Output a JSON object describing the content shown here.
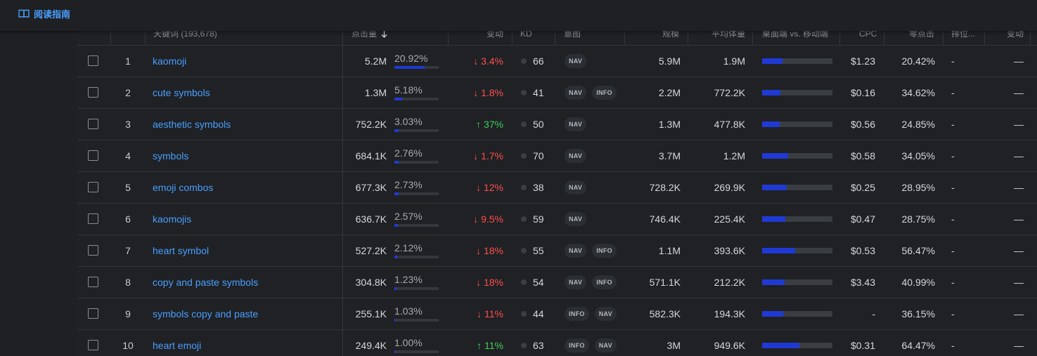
{
  "topbar": {
    "guide_label": "阅读指南"
  },
  "headers": {
    "keyword": "天键词 (193,678)",
    "clicks": "点击量",
    "change": "变动",
    "kd": "KD",
    "intent": "意图",
    "scale": "规模",
    "avg_volume": "平均体量",
    "desktop_mobile": "桌面端 vs. 移动端",
    "cpc": "CPC",
    "zero_click": "零点击",
    "rank": "排位...",
    "change2": "变动"
  },
  "rows": [
    {
      "num": "1",
      "keyword": "kaomoji",
      "clicks": "5.2M",
      "share": "20.92%",
      "share_pct": 20.92,
      "change": "↓ 3.4%",
      "dir": "down",
      "kd": "66",
      "intents": [
        "NAV"
      ],
      "scale": "5.9M",
      "avg": "1.9M",
      "desktop_frac": 0.29,
      "cpc": "$1.23",
      "zero": "20.42%",
      "rank": "-",
      "chg2": "—"
    },
    {
      "num": "2",
      "keyword": "cute symbols",
      "clicks": "1.3M",
      "share": "5.18%",
      "share_pct": 5.18,
      "change": "↓ 1.8%",
      "dir": "down",
      "kd": "41",
      "intents": [
        "NAV",
        "INFO"
      ],
      "scale": "2.2M",
      "avg": "772.2K",
      "desktop_frac": 0.26,
      "cpc": "$0.16",
      "zero": "34.62%",
      "rank": "-",
      "chg2": "—"
    },
    {
      "num": "3",
      "keyword": "aesthetic symbols",
      "clicks": "752.2K",
      "share": "3.03%",
      "share_pct": 3.03,
      "change": "↑ 37%",
      "dir": "up",
      "kd": "50",
      "intents": [
        "NAV"
      ],
      "scale": "1.3M",
      "avg": "477.8K",
      "desktop_frac": 0.25,
      "cpc": "$0.56",
      "zero": "24.85%",
      "rank": "-",
      "chg2": "—"
    },
    {
      "num": "4",
      "keyword": "symbols",
      "clicks": "684.1K",
      "share": "2.76%",
      "share_pct": 2.76,
      "change": "↓ 1.7%",
      "dir": "down",
      "kd": "70",
      "intents": [
        "NAV"
      ],
      "scale": "3.7M",
      "avg": "1.2M",
      "desktop_frac": 0.37,
      "cpc": "$0.58",
      "zero": "34.05%",
      "rank": "-",
      "chg2": "—"
    },
    {
      "num": "5",
      "keyword": "emoji combos",
      "clicks": "677.3K",
      "share": "2.73%",
      "share_pct": 2.73,
      "change": "↓ 12%",
      "dir": "down",
      "kd": "38",
      "intents": [
        "NAV"
      ],
      "scale": "728.2K",
      "avg": "269.9K",
      "desktop_frac": 0.35,
      "cpc": "$0.25",
      "zero": "28.95%",
      "rank": "-",
      "chg2": "—"
    },
    {
      "num": "6",
      "keyword": "kaomojis",
      "clicks": "636.7K",
      "share": "2.57%",
      "share_pct": 2.57,
      "change": "↓ 9.5%",
      "dir": "down",
      "kd": "59",
      "intents": [
        "NAV"
      ],
      "scale": "746.4K",
      "avg": "225.4K",
      "desktop_frac": 0.33,
      "cpc": "$0.47",
      "zero": "28.75%",
      "rank": "-",
      "chg2": "—"
    },
    {
      "num": "7",
      "keyword": "heart symbol",
      "clicks": "527.2K",
      "share": "2.12%",
      "share_pct": 2.12,
      "change": "↓ 18%",
      "dir": "down",
      "kd": "55",
      "intents": [
        "NAV",
        "INFO"
      ],
      "scale": "1.1M",
      "avg": "393.6K",
      "desktop_frac": 0.47,
      "cpc": "$0.53",
      "zero": "56.47%",
      "rank": "-",
      "chg2": "—"
    },
    {
      "num": "8",
      "keyword": "copy and paste symbols",
      "clicks": "304.8K",
      "share": "1.23%",
      "share_pct": 1.23,
      "change": "↓ 18%",
      "dir": "down",
      "kd": "54",
      "intents": [
        "NAV",
        "INFO"
      ],
      "scale": "571.1K",
      "avg": "212.2K",
      "desktop_frac": 0.32,
      "cpc": "$3.43",
      "zero": "40.99%",
      "rank": "-",
      "chg2": "—"
    },
    {
      "num": "9",
      "keyword": "symbols copy and paste",
      "clicks": "255.1K",
      "share": "1.03%",
      "share_pct": 1.03,
      "change": "↓ 11%",
      "dir": "down",
      "kd": "44",
      "intents": [
        "INFO",
        "NAV"
      ],
      "scale": "582.3K",
      "avg": "194.3K",
      "desktop_frac": 0.3,
      "cpc": "-",
      "zero": "36.15%",
      "rank": "-",
      "chg2": "—"
    },
    {
      "num": "10",
      "keyword": "heart emoji",
      "clicks": "249.4K",
      "share": "1.00%",
      "share_pct": 1.0,
      "change": "↑ 11%",
      "dir": "up",
      "kd": "63",
      "intents": [
        "INFO",
        "NAV"
      ],
      "scale": "3M",
      "avg": "949.6K",
      "desktop_frac": 0.53,
      "cpc": "$0.31",
      "zero": "64.47%",
      "rank": "-",
      "chg2": "—"
    }
  ]
}
